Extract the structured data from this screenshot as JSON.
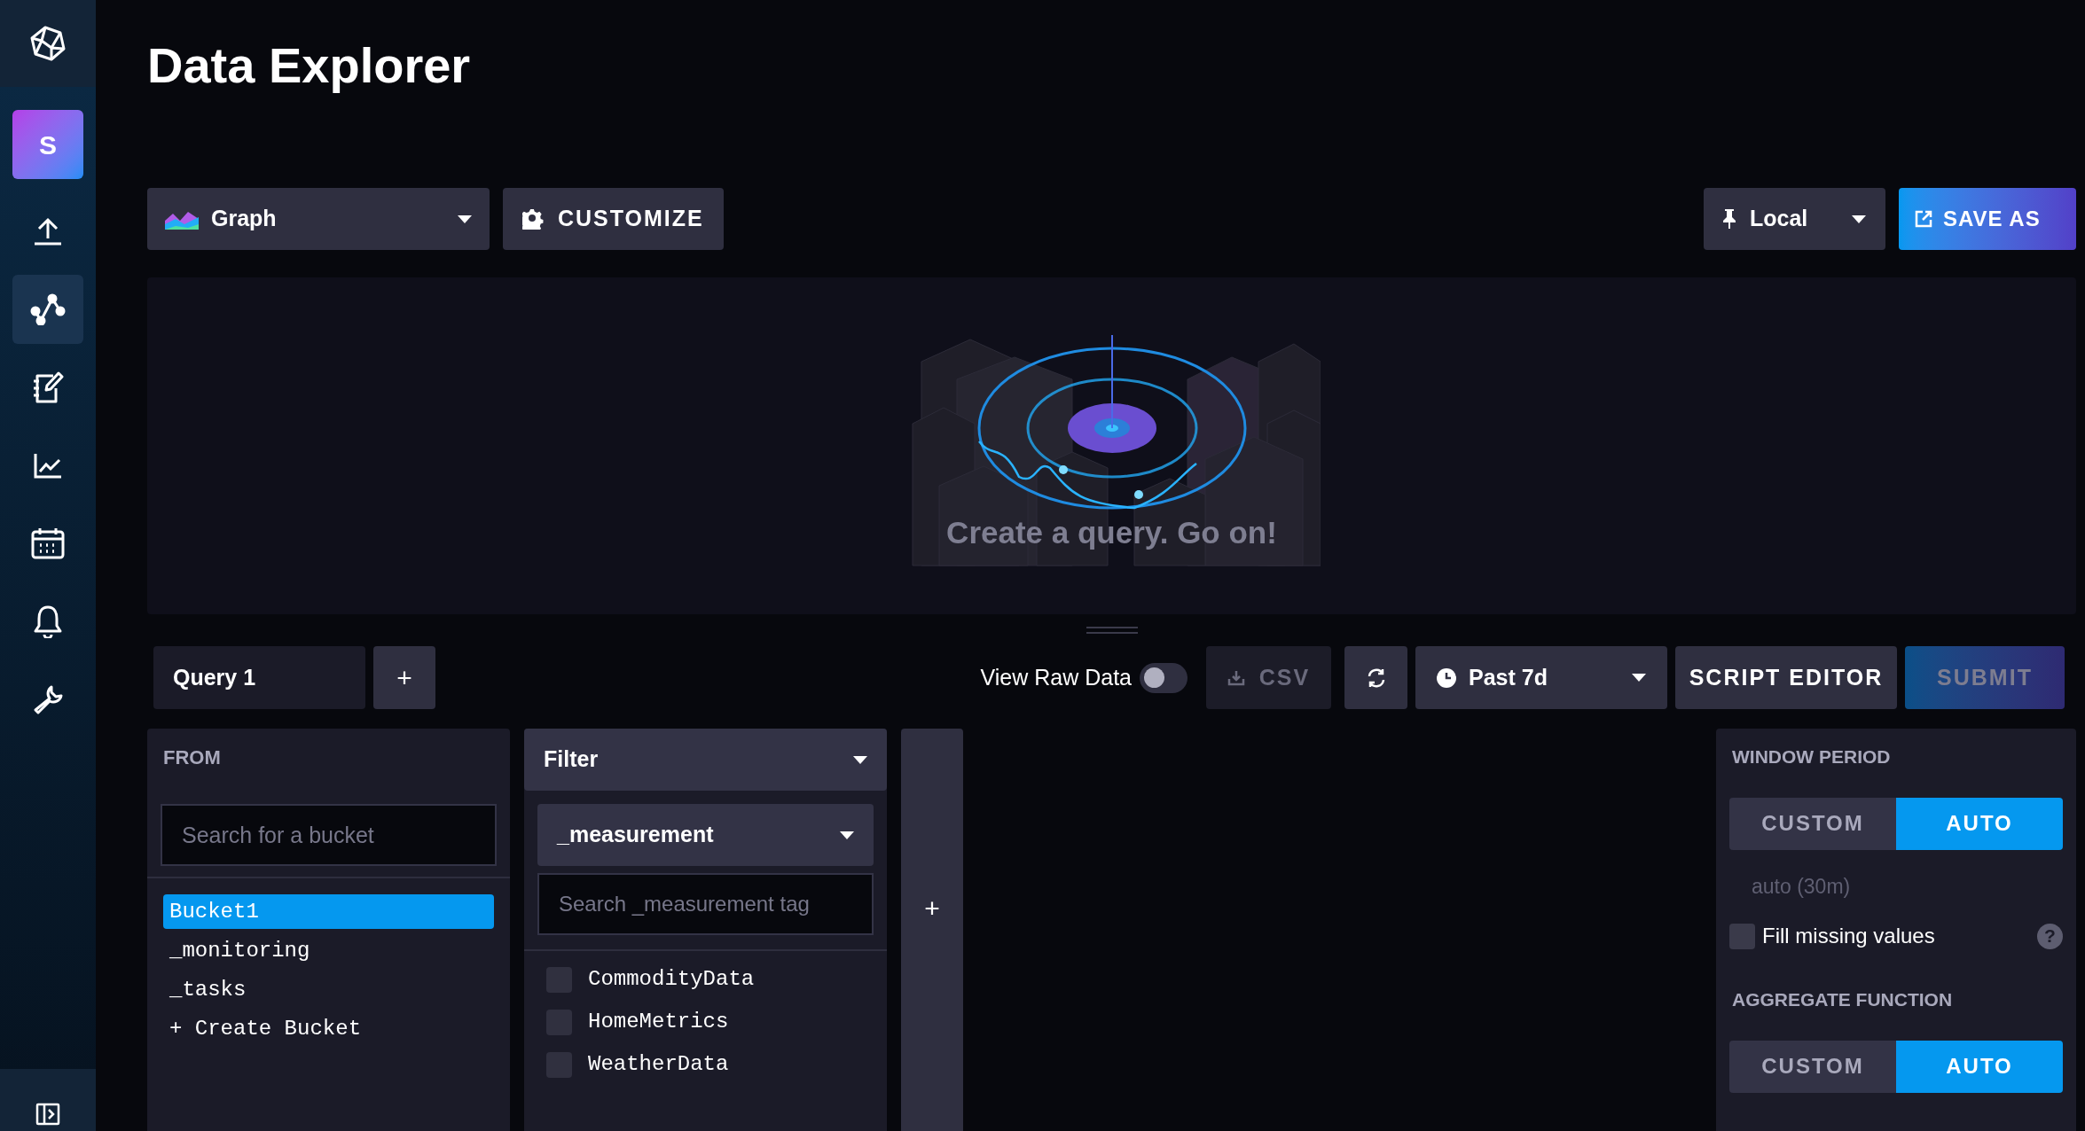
{
  "sidebar": {
    "avatar": "S",
    "items": [
      {
        "selected": false
      },
      {
        "selected": true
      },
      {
        "selected": false
      },
      {
        "selected": false
      },
      {
        "selected": false
      },
      {
        "selected": false
      },
      {
        "selected": false
      }
    ]
  },
  "page_title": "Data Explorer",
  "toolbar": {
    "visualization": "Graph",
    "customize": "CUSTOMIZE",
    "timezone": "Local",
    "save_as": "SAVE AS"
  },
  "graph": {
    "message": "Create a query. Go on!"
  },
  "query_tabs": [
    {
      "label": "Query 1",
      "selected": true
    }
  ],
  "add_query": "+",
  "view_raw_data": {
    "label": "View Raw Data",
    "on": false
  },
  "csv": {
    "label": "CSV",
    "disabled": true
  },
  "time_range": "Past 7d",
  "script_editor": "SCRIPT EDITOR",
  "submit": {
    "label": "SUBMIT",
    "disabled": true
  },
  "from": {
    "title": "FROM",
    "search": {
      "placeholder": "Search for a bucket"
    },
    "buckets": [
      {
        "label": "Bucket1",
        "selected": true
      },
      {
        "label": "_monitoring",
        "selected": false
      },
      {
        "label": "_tasks",
        "selected": false
      }
    ],
    "create": "+ Create Bucket"
  },
  "filter": {
    "title": "Filter",
    "key": "_measurement",
    "search": {
      "placeholder": "Search _measurement tag"
    },
    "values": [
      {
        "label": "CommodityData",
        "checked": false
      },
      {
        "label": "HomeMetrics",
        "checked": false
      },
      {
        "label": "WeatherData",
        "checked": false
      }
    ]
  },
  "add_filter": "+",
  "window_period": {
    "title": "WINDOW PERIOD",
    "options": [
      {
        "label": "CUSTOM",
        "selected": false
      },
      {
        "label": "AUTO",
        "selected": true
      }
    ],
    "hint": "auto (30m)",
    "fill_missing": {
      "label": "Fill missing values",
      "checked": false
    },
    "help": "?"
  },
  "aggregate_function": {
    "title": "AGGREGATE FUNCTION",
    "options": [
      {
        "label": "CUSTOM",
        "selected": false
      },
      {
        "label": "AUTO",
        "selected": true
      }
    ]
  }
}
